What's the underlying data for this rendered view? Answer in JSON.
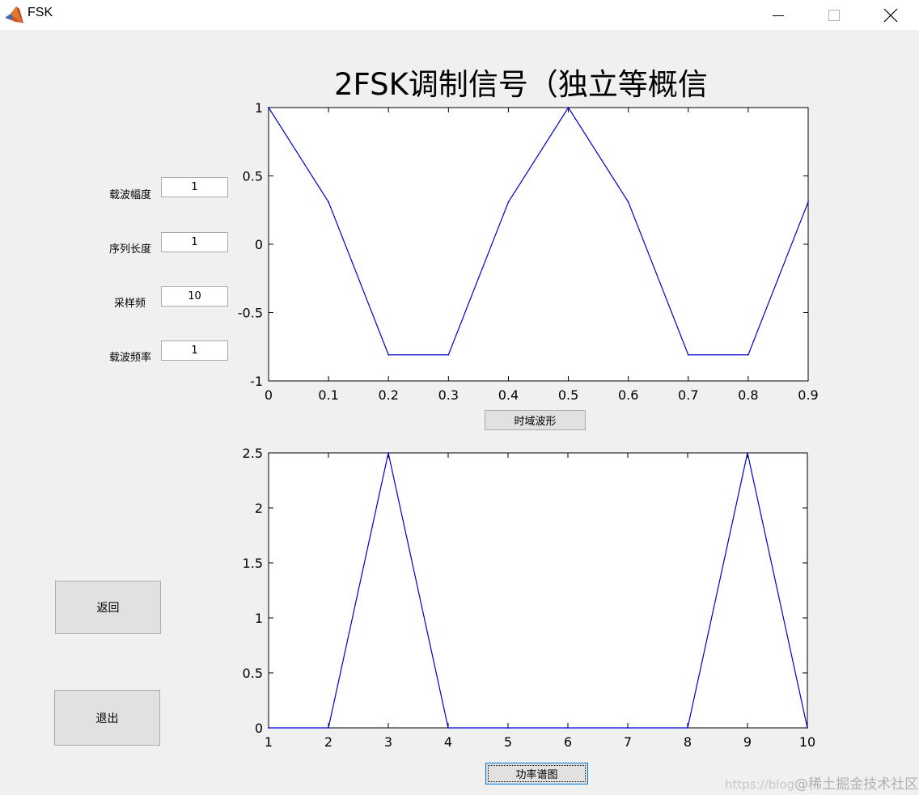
{
  "window": {
    "title": "FSK"
  },
  "fields": [
    {
      "label": "载波幅度",
      "value": "1"
    },
    {
      "label": "序列长度",
      "value": "1"
    },
    {
      "label": "采样频",
      "value": "10"
    },
    {
      "label": "载波频率",
      "value": "1"
    }
  ],
  "buttons": {
    "back_label": "返回",
    "exit_label": "退出",
    "time_domain_label": "时域波形",
    "power_spectrum_label": "功率谱图"
  },
  "plot_title": "2FSK调制信号（独立等概信",
  "watermark": {
    "url_text": "https://blog",
    "brand_text": "@稀土掘金技术社区"
  },
  "colors": {
    "line": "#0000cc",
    "window_bg": "#f0f0f0",
    "titlebar_bg": "#ffffff"
  },
  "icons": {
    "app": "matlab-icon",
    "minimize": "minimize-icon",
    "maximize": "maximize-icon",
    "close": "close-icon"
  },
  "chart_data": [
    {
      "type": "line",
      "title": "2FSK调制信号（独立等概信",
      "x": [
        0,
        0.1,
        0.2,
        0.3,
        0.4,
        0.5,
        0.6,
        0.7,
        0.8,
        0.9
      ],
      "series": [
        {
          "values": [
            1,
            0.309,
            -0.809,
            -0.809,
            0.309,
            1,
            0.309,
            -0.809,
            -0.809,
            0.309
          ]
        }
      ],
      "xlim": [
        0,
        0.9
      ],
      "ylim": [
        -1,
        1
      ],
      "xticks": [
        "0",
        "0.1",
        "0.2",
        "0.3",
        "0.4",
        "0.5",
        "0.6",
        "0.7",
        "0.8",
        "0.9"
      ],
      "yticks": [
        "-1",
        "-0.5",
        "0",
        "0.5",
        "1"
      ],
      "xtick_values": [
        0,
        0.1,
        0.2,
        0.3,
        0.4,
        0.5,
        0.6,
        0.7,
        0.8,
        0.9
      ],
      "ytick_values": [
        -1,
        -0.5,
        0,
        0.5,
        1
      ],
      "grid": false
    },
    {
      "type": "line",
      "x": [
        1,
        2,
        3,
        4,
        5,
        6,
        7,
        8,
        9,
        10
      ],
      "series": [
        {
          "values": [
            0,
            0,
            2.5,
            0,
            0,
            0,
            0,
            0,
            2.5,
            0
          ]
        }
      ],
      "xlim": [
        1,
        10
      ],
      "ylim": [
        0,
        2.5
      ],
      "xticks": [
        "1",
        "2",
        "3",
        "4",
        "5",
        "6",
        "7",
        "8",
        "9",
        "10"
      ],
      "yticks": [
        "0",
        "0.5",
        "1",
        "1.5",
        "2",
        "2.5"
      ],
      "xtick_values": [
        1,
        2,
        3,
        4,
        5,
        6,
        7,
        8,
        9,
        10
      ],
      "ytick_values": [
        0,
        0.5,
        1,
        1.5,
        2,
        2.5
      ],
      "grid": false
    }
  ]
}
